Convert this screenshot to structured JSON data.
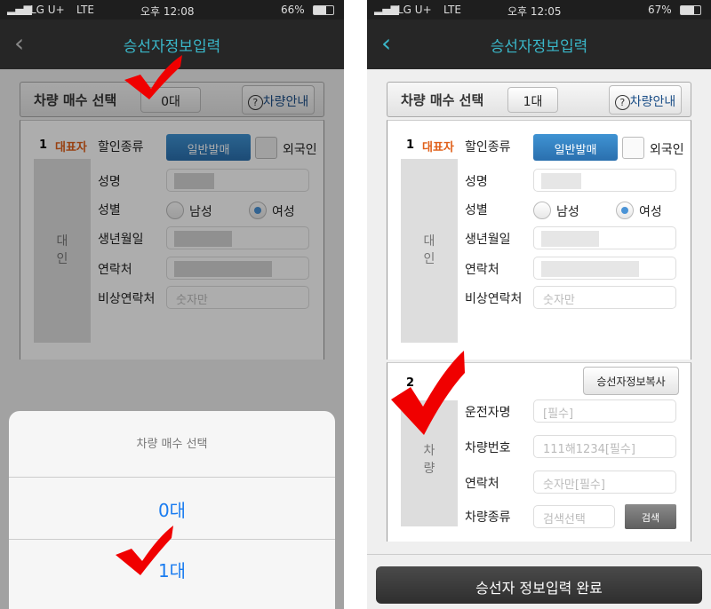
{
  "left": {
    "status": {
      "carrier": "LG U+",
      "network": "LTE",
      "time": "오후 12:08",
      "battery": "66%"
    },
    "title": "승선자정보입력",
    "vehicle_count_label": "차량 매수 선택",
    "vehicle_count_value": "0대",
    "vehicle_guide": "차량안내",
    "passenger": {
      "index": "1",
      "rep": "대표자",
      "type_label": "대인",
      "discount_label": "할인종류",
      "discount_value": "일반발매",
      "foreigner": "외국인",
      "name_label": "성명",
      "gender_label": "성별",
      "male": "남성",
      "female": "여성",
      "birth_label": "생년월일",
      "phone_label": "연락처",
      "emergency_label": "비상연락처",
      "emergency_placeholder": "숫자만"
    },
    "sheet": {
      "title": "차량 매수 선택",
      "options": [
        "0대",
        "1대"
      ]
    }
  },
  "right": {
    "status": {
      "carrier": "LG U+",
      "network": "LTE",
      "time": "오후 12:05",
      "battery": "67%"
    },
    "title": "승선자정보입력",
    "vehicle_count_label": "차량 매수 선택",
    "vehicle_count_value": "1대",
    "vehicle_guide": "차량안내",
    "passenger": {
      "index": "1",
      "rep": "대표자",
      "type_label": "대인",
      "discount_label": "할인종류",
      "discount_value": "일반발매",
      "foreigner": "외국인",
      "name_label": "성명",
      "gender_label": "성별",
      "male": "남성",
      "female": "여성",
      "birth_label": "생년월일",
      "phone_label": "연락처",
      "emergency_label": "비상연락처",
      "emergency_placeholder": "숫자만"
    },
    "vehicle": {
      "index": "2",
      "type_label": "차량",
      "copy_button": "승선자정보복사",
      "driver_label": "운전자명",
      "driver_placeholder": "[필수]",
      "plate_label": "차량번호",
      "plate_placeholder": "111해1234[필수]",
      "phone_label": "연락처",
      "phone_placeholder": "숫자만[필수]",
      "kind_label": "차량종류",
      "kind_placeholder": "검색선택",
      "search_button": "검색"
    },
    "submit": "승선자 정보입력 완료"
  },
  "colors": {
    "accent": "#3ab7c9",
    "rep": "#e0601a",
    "primary_button": "#2f7fbf",
    "ios_blue": "#1a7cf0",
    "checkmark": "#f00000"
  }
}
